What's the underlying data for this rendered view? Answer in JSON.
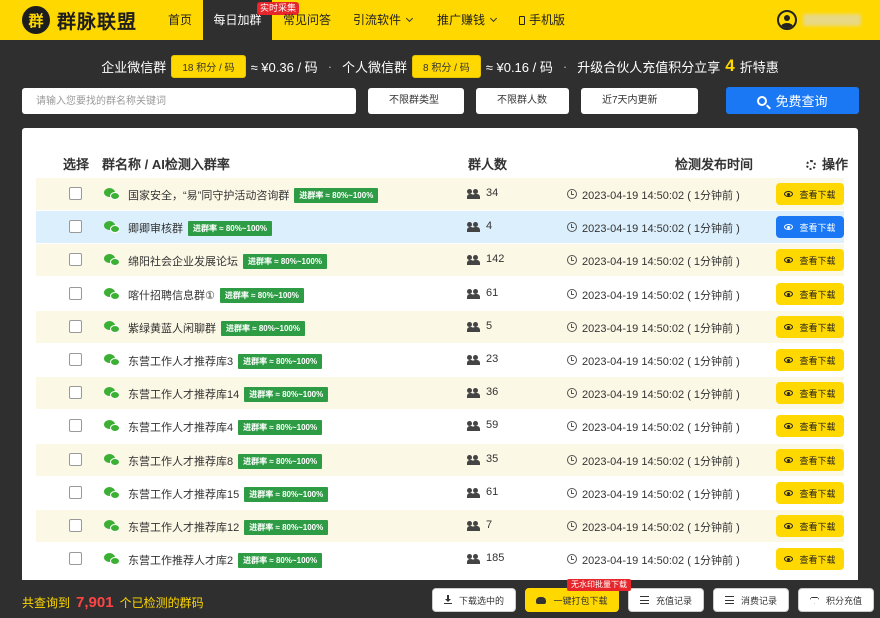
{
  "nav": {
    "logo_mark": "群",
    "logo_text": "群脉联盟",
    "items": [
      {
        "label": "首页"
      },
      {
        "label": "每日加群",
        "badge": "实时采集"
      },
      {
        "label": "常见问答"
      },
      {
        "label": "引流软件"
      },
      {
        "label": "推广赚钱"
      },
      {
        "label": "手机版"
      }
    ]
  },
  "promo": {
    "enterprise_label": "企业微信群",
    "enterprise_points": "18 积分 / 码",
    "enterprise_price": "≈ ¥0.36 / 码",
    "dot": "·",
    "personal_label": "个人微信群",
    "personal_points": "8 积分 / 码",
    "personal_price": "≈ ¥0.16 / 码",
    "upgrade_prefix": "升级合伙人充值积分立享",
    "upgrade_num": "4",
    "upgrade_suffix": "折特惠"
  },
  "search": {
    "placeholder": "请输入您要找的群名称关键词",
    "type_select": "不限群类型",
    "size_select": "不限群人数",
    "time_select": "近7天内更新",
    "button": "免费查询"
  },
  "table": {
    "headers": {
      "select": "选择",
      "name": "群名称 / AI检测入群率",
      "members": "群人数",
      "time": "检测发布时间",
      "action": "操作"
    },
    "rate_tag": "进群率 ≈ 80%~100%",
    "view_label": "查看下载",
    "rows": [
      {
        "name": "国家安全，“易”同守护活动咨询群",
        "count": "34",
        "time": "2023-04-19 14:50:02 ( 1分钟前 )"
      },
      {
        "name": "卿卿审核群",
        "count": "4",
        "time": "2023-04-19 14:50:02 ( 1分钟前 )"
      },
      {
        "name": "绵阳社会企业发展论坛",
        "count": "142",
        "time": "2023-04-19 14:50:02 ( 1分钟前 )"
      },
      {
        "name": "喀什招聘信息群①",
        "count": "61",
        "time": "2023-04-19 14:50:02 ( 1分钟前 )"
      },
      {
        "name": "紫绿黄蓝人闲聊群",
        "count": "5",
        "time": "2023-04-19 14:50:02 ( 1分钟前 )"
      },
      {
        "name": "东营工作人才推荐库3",
        "count": "23",
        "time": "2023-04-19 14:50:02 ( 1分钟前 )"
      },
      {
        "name": "东营工作人才推荐库14",
        "count": "36",
        "time": "2023-04-19 14:50:02 ( 1分钟前 )"
      },
      {
        "name": "东营工作人才推荐库4",
        "count": "59",
        "time": "2023-04-19 14:50:02 ( 1分钟前 )"
      },
      {
        "name": "东营工作人才推荐库8",
        "count": "35",
        "time": "2023-04-19 14:50:02 ( 1分钟前 )"
      },
      {
        "name": "东营工作人才推荐库15",
        "count": "61",
        "time": "2023-04-19 14:50:02 ( 1分钟前 )"
      },
      {
        "name": "东营工作人才推荐库12",
        "count": "7",
        "time": "2023-04-19 14:50:02 ( 1分钟前 )"
      },
      {
        "name": "东营工作推荐人才库2",
        "count": "185",
        "time": "2023-04-19 14:50:02 ( 1分钟前 )"
      }
    ]
  },
  "footer": {
    "total_prefix": "共查询到",
    "total_count": "7,901",
    "total_suffix": "个已检测的群码",
    "download_selected": "下载选中的",
    "pack_download": "一键打包下载",
    "pack_badge": "无水印批量下载",
    "recharge_record": "充值记录",
    "consume_record": "消费记录",
    "points_recharge": "积分充值"
  },
  "colors": {
    "brand_yellow": "#ffd800",
    "dark_bg": "#2f2f2f",
    "primary_blue": "#1a78f5",
    "rate_green": "#2e9c45",
    "badge_red": "#e6262b"
  }
}
